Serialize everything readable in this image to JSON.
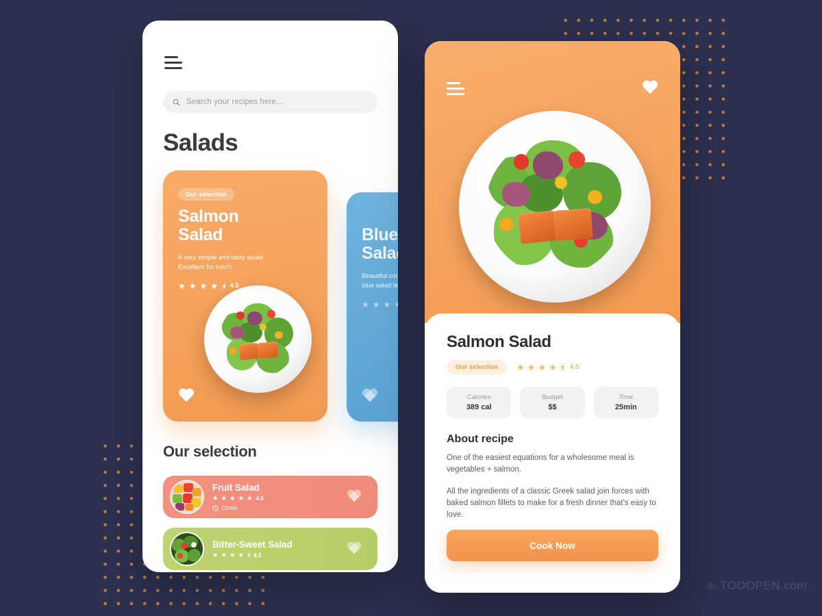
{
  "background": {
    "color": "#2d3150",
    "dot_color": "#c17a46"
  },
  "list_screen": {
    "menu_icon": "hamburger-icon",
    "search": {
      "icon": "search-icon",
      "placeholder": "Search your recipes here..."
    },
    "title": "Salads",
    "carousel": [
      {
        "badge": "Our selection",
        "title": "Salmon\nSalad",
        "description": "A very simple and tasty salad.\nExcellent for lunch.",
        "rating": "4.5",
        "stars": [
          "full",
          "full",
          "full",
          "full",
          "half"
        ],
        "favorite_icon": "heart-icon",
        "color": "#f29a52"
      },
      {
        "badge": "",
        "title": "Blueberry\nSalad",
        "description": "Beautiful combination of\nblue salad leaves.",
        "rating": "",
        "stars": [
          "full",
          "full",
          "full",
          "full",
          "half"
        ],
        "favorite_icon": "heart-icon",
        "color": "#59a2d4"
      }
    ],
    "selection_heading": "Our selection",
    "recommendations": [
      {
        "name": "Fruit Salad",
        "rating": "4.8",
        "stars": [
          "full",
          "full",
          "full",
          "full",
          "full"
        ],
        "time": "10min",
        "time_icon": "clock-icon",
        "favorite_icon": "heart-icon",
        "color": "#f08f7d"
      },
      {
        "name": "Bitter-Sweet Salad",
        "rating": "4.3",
        "stars": [
          "full",
          "full",
          "full",
          "full",
          "half"
        ],
        "time": "",
        "time_icon": "clock-icon",
        "favorite_icon": "heart-icon",
        "color": "#b8cf6d"
      }
    ]
  },
  "detail_screen": {
    "menu_icon": "hamburger-icon",
    "favorite_icon": "heart-icon",
    "hero_image": "salmon-salad-plate-photo",
    "title": "Salmon Salad",
    "badge": "Our selection",
    "rating": "4.5",
    "stars": [
      "full",
      "full",
      "full",
      "full",
      "half"
    ],
    "facts": [
      {
        "label": "Calories",
        "value": "389 cal"
      },
      {
        "label": "Budget",
        "value": "$$"
      },
      {
        "label": "Time",
        "value": "25min"
      }
    ],
    "about_heading": "About recipe",
    "about_paragraphs": [
      "One of the easiest equations for a wholesome meal is vegetables + salmon.",
      "All the ingredients of a classic Greek salad join forces with baked salmon fillets to make for a fresh dinner that's easy to love."
    ],
    "cta": "Cook Now"
  },
  "watermark": {
    "icon": "cloud-upload-icon",
    "text": "TOOOPEN.com"
  }
}
